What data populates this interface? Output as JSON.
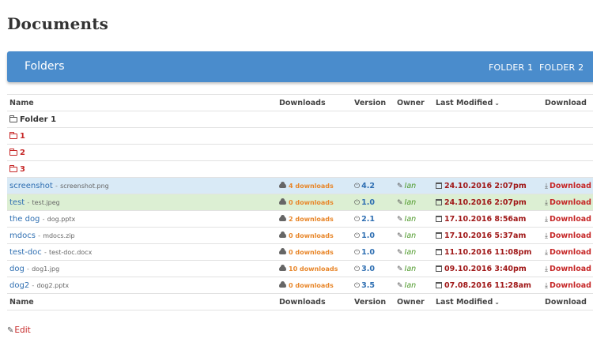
{
  "page": {
    "title": "Documents"
  },
  "folders_bar": {
    "title": "Folders",
    "nav": [
      "FOLDER 1",
      "FOLDER 2"
    ]
  },
  "columns": {
    "name": "Name",
    "downloads": "Downloads",
    "version": "Version",
    "owner": "Owner",
    "last_modified": "Last Modified",
    "download": "Download"
  },
  "folders": [
    {
      "name": "Folder 1",
      "icon": "folder-open-icon"
    },
    {
      "name": "1",
      "icon": "folder-icon"
    },
    {
      "name": "2",
      "icon": "folder-icon"
    },
    {
      "name": "3",
      "icon": "folder-icon"
    }
  ],
  "files": [
    {
      "title": "screenshot",
      "filename": "screenshot.png",
      "downloads": "4 downloads",
      "version": "4.2",
      "owner": "Ian",
      "modified": "24.10.2016 2:07pm",
      "action": "Download",
      "highlight": "blue"
    },
    {
      "title": "test",
      "filename": "test.jpeg",
      "downloads": "0 downloads",
      "version": "1.0",
      "owner": "Ian",
      "modified": "24.10.2016 2:07pm",
      "action": "Download",
      "highlight": "green"
    },
    {
      "title": "the dog",
      "filename": "dog.pptx",
      "downloads": "2 downloads",
      "version": "2.1",
      "owner": "Ian",
      "modified": "17.10.2016 8:56am",
      "action": "Download",
      "highlight": ""
    },
    {
      "title": "mdocs",
      "filename": "mdocs.zip",
      "downloads": "0 downloads",
      "version": "1.0",
      "owner": "Ian",
      "modified": "17.10.2016 5:37am",
      "action": "Download",
      "highlight": ""
    },
    {
      "title": "test-doc",
      "filename": "test-doc.docx",
      "downloads": "0 downloads",
      "version": "1.0",
      "owner": "Ian",
      "modified": "11.10.2016 11:08pm",
      "action": "Download",
      "highlight": ""
    },
    {
      "title": "dog",
      "filename": "dog1.jpg",
      "downloads": "10 downloads",
      "version": "3.0",
      "owner": "Ian",
      "modified": "09.10.2016 3:40pm",
      "action": "Download",
      "highlight": ""
    },
    {
      "title": "dog2",
      "filename": "dog2.pptx",
      "downloads": "0 downloads",
      "version": "3.5",
      "owner": "Ian",
      "modified": "07.08.2016 11:28am",
      "action": "Download",
      "highlight": ""
    }
  ],
  "file_separator": "-",
  "edit": {
    "label": "Edit"
  },
  "colors": {
    "bar": "#4a8ccc",
    "accent_red": "#c62828",
    "link_blue": "#2f6fb2",
    "downloads_orange": "#e8872b",
    "owner_green": "#4e9a2a",
    "row_blue": "#d9eaf6",
    "row_green": "#dcefd3"
  }
}
